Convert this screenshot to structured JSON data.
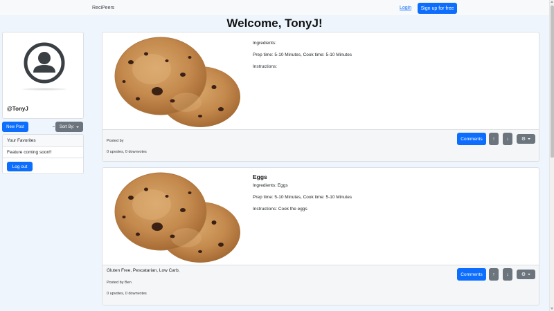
{
  "app": {
    "brand": "ReciPeers"
  },
  "nav": {
    "login_label": "Login",
    "signup_label": "Sign up for free"
  },
  "welcome": "Welcome, TonyJ!",
  "profile": {
    "username": "@TonyJ"
  },
  "actions": {
    "new_post_label": "New Post",
    "sort_label": "Sort By:"
  },
  "favorites": {
    "header": "Your Favorites",
    "body": "Feature coming soon!!",
    "logout_label": "Log out"
  },
  "posts": [
    {
      "title": "",
      "ingredients": "Ingredients:",
      "times": "Prep time: 5-10 Minutes, Cook time: 5-10 Minutes",
      "instructions": "Instructions:",
      "tags": "",
      "posted_by": "Posted by",
      "votes": "0 upvotes, 0 downvotes",
      "comments_label": "Comments",
      "upvote_icon": "↑",
      "downvote_icon": "↓",
      "settings_icon": "⚙"
    },
    {
      "title": "Eggs",
      "ingredients": "Ingredients: Eggs",
      "times": "Prep time: 5-10 Minutes, Cook time: 5-10 Minutes",
      "instructions": "Instructions: Cook the eggs",
      "tags": "Gluten Free, Pescatarian, Low Carb,",
      "posted_by": "Posted by Ben",
      "votes": "0 upvotes, 0 downvotes",
      "comments_label": "Comments",
      "upvote_icon": "↑",
      "downvote_icon": "↓",
      "settings_icon": "⚙"
    }
  ],
  "colors": {
    "primary": "#0d6efd",
    "secondary": "#6c757d",
    "page_bg": "#eef5fd"
  }
}
